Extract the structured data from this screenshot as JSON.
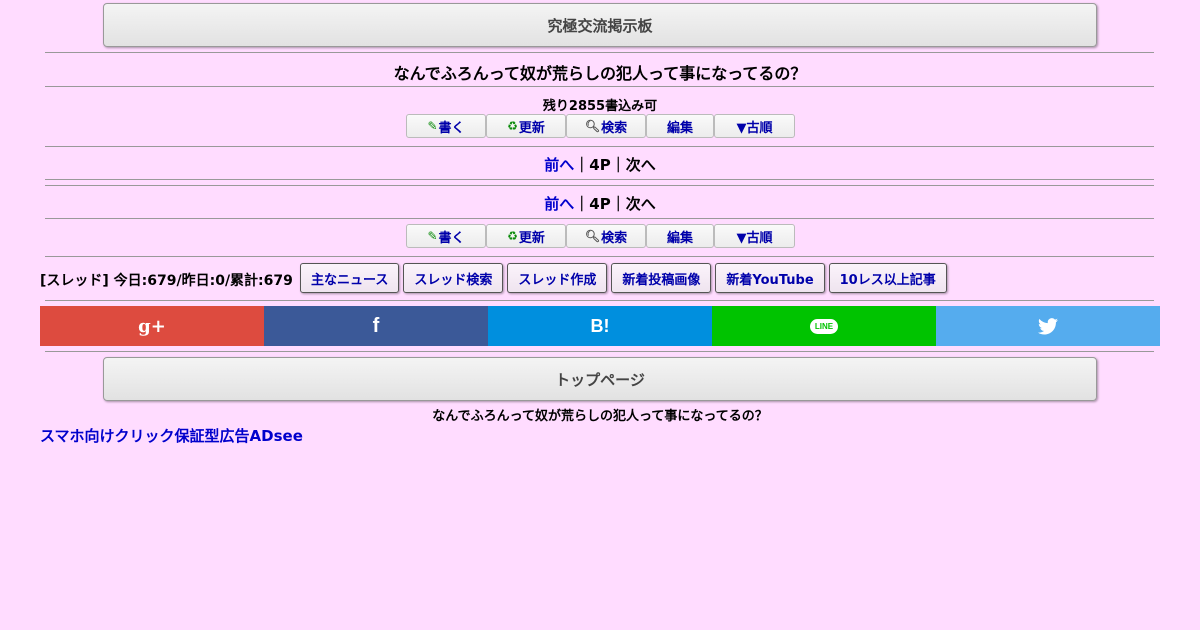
{
  "header": {
    "board_title": "究極交流掲示板"
  },
  "thread": {
    "title": "なんでふろんって奴が荒らしの犯人って事になってるの？",
    "remaining": "残り2855書込み可"
  },
  "toolbar": {
    "write": "書く",
    "refresh": "更新",
    "search": "検索",
    "edit": "編集",
    "old_order": "▼古順"
  },
  "pager": {
    "prev": "前へ",
    "sep": "｜",
    "page": "4P",
    "next": "次へ"
  },
  "stats": {
    "text": "[スレッド] 今日:679/昨日:0/累計:679"
  },
  "nav": {
    "items": [
      "主なニュース",
      "スレッド検索",
      "スレッド作成",
      "新着投稿画像",
      "新着YouTube",
      "10レス以上記事"
    ]
  },
  "share": {
    "colors": {
      "gplus": "#dd4b3f",
      "facebook": "#3b5998",
      "hatena": "#008fde",
      "line": "#00c300",
      "twitter": "#55acee"
    },
    "gplus_label": "g+",
    "facebook_label": "f",
    "hatena_label": "B!",
    "line_label": "LINE"
  },
  "footer": {
    "top_page": "トップページ",
    "thread_title": "なんでふろんって奴が荒らしの犯人って事になってるの？",
    "ad_link": "スマホ向けクリック保証型広告ADsee"
  }
}
